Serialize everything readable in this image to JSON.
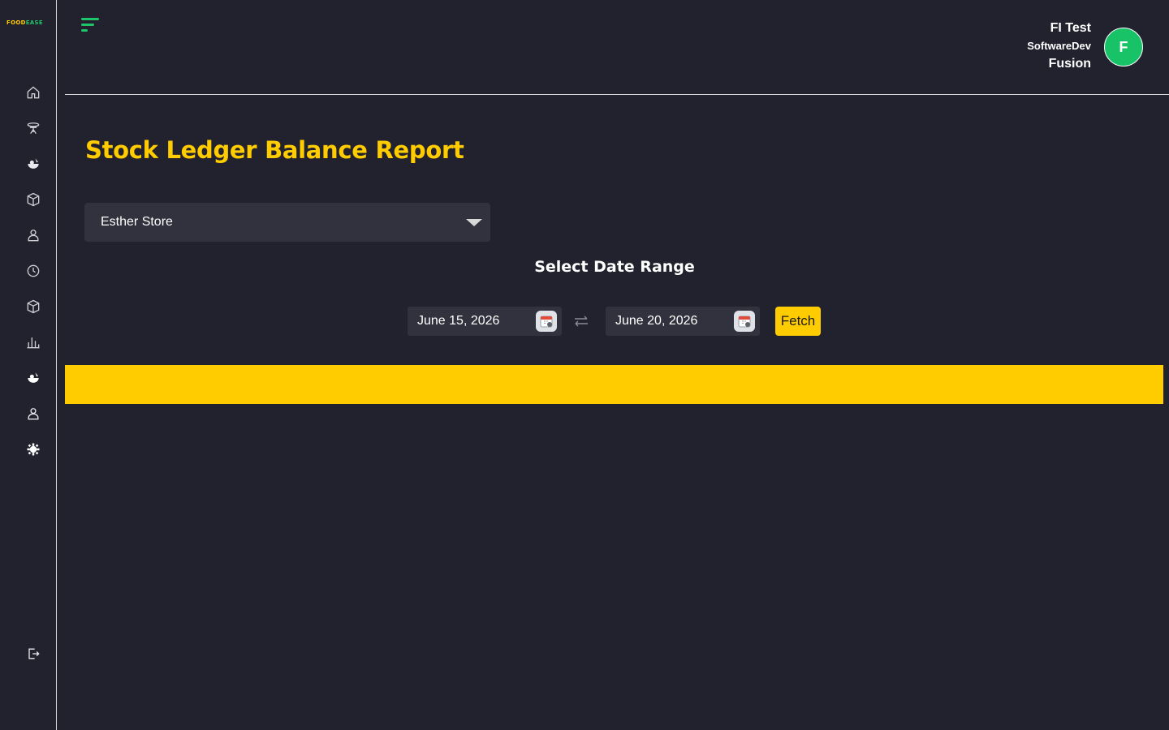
{
  "brand": {
    "logo_part1": "FOOD",
    "logo_part2": "EASE",
    "accent_color": "#ffcc00",
    "brand_green": "#1ec46a"
  },
  "sidebar": {
    "items": [
      {
        "icon": "home-icon"
      },
      {
        "icon": "dining-table-icon"
      },
      {
        "icon": "food-bowl-icon"
      },
      {
        "icon": "box-icon"
      },
      {
        "icon": "user-icon"
      },
      {
        "icon": "clock-icon"
      },
      {
        "icon": "package-icon"
      },
      {
        "icon": "bar-chart-icon"
      },
      {
        "icon": "food-basket-icon"
      },
      {
        "icon": "user-profile-icon"
      },
      {
        "icon": "gear-icon"
      }
    ],
    "logout_icon": "logout-icon"
  },
  "header": {
    "user_name": "FI Test",
    "user_role": "SoftwareDev",
    "user_company": "Fusion",
    "avatar_initial": "F"
  },
  "page": {
    "title": "Stock Ledger Balance Report",
    "store_select_value": "Esther Store",
    "date_range_label": "Select Date Range",
    "start_date": "June 15, 2026",
    "end_date": "June 20, 2026",
    "fetch_label": "Fetch"
  }
}
